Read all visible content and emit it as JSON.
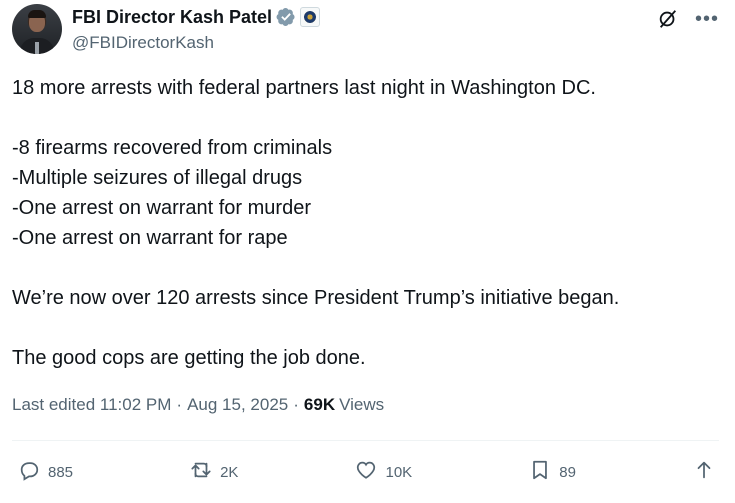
{
  "author": {
    "display_name": "FBI Director Kash Patel",
    "handle": "@FBIDirectorKash"
  },
  "icons": {
    "verified": "verified-badge-icon",
    "affiliation": "fbi-seal-icon",
    "grok": "grok-icon",
    "more": "more-options-icon"
  },
  "post": {
    "lines": [
      "18 more arrests with federal partners last night in Washington DC.",
      "",
      "-8 firearms recovered from criminals",
      "-Multiple seizures of illegal drugs",
      "-One arrest on warrant for murder",
      "-One arrest on warrant for rape",
      "",
      "We’re now over 120 arrests since President Trump’s initiative began.",
      "",
      "The good cops are getting the job done."
    ]
  },
  "meta": {
    "edited_label": "Last edited 11:02 PM",
    "separator": "·",
    "date": "Aug 15, 2025",
    "views_count": "69K",
    "views_label": "Views"
  },
  "actions": {
    "replies": "885",
    "reposts": "2K",
    "likes": "10K",
    "bookmarks": "89"
  },
  "colors": {
    "text": "#0f1419",
    "secondary": "#536471",
    "verified": "#829aab"
  }
}
